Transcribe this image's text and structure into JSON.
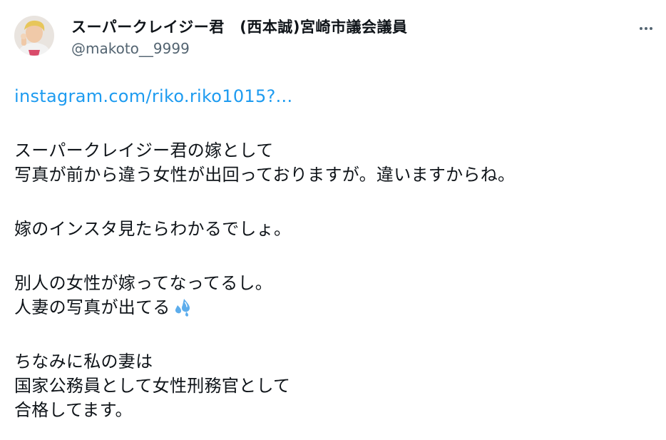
{
  "author": {
    "display_name": "スーパークレイジー君　(西本誠)宮崎市議会議員",
    "handle": "@makoto__9999",
    "avatar_icon": "user-avatar"
  },
  "more_icon": "more-options-icon",
  "tweet": {
    "link": "instagram.com/riko.riko1015?...",
    "paragraph1": {
      "line1": "スーパークレイジー君の嫁として",
      "line2": "写真が前から違う女性が出回っておりますが。違いますからね。"
    },
    "paragraph2": {
      "line1": "嫁のインスタ見たらわかるでしょ。"
    },
    "paragraph3": {
      "line1": "別人の女性が嫁ってなってるし。",
      "line2": "人妻の写真が出てる",
      "emoji": "sweat-droplets-emoji"
    },
    "paragraph4": {
      "line1": "ちなみに私の妻は",
      "line2": "国家公務員として女性刑務官として",
      "line3": "合格してます。"
    }
  },
  "colors": {
    "link": "#1d9bf0",
    "secondary_text": "#536471",
    "primary_text": "#0f1419",
    "emoji": "#5dadec"
  }
}
